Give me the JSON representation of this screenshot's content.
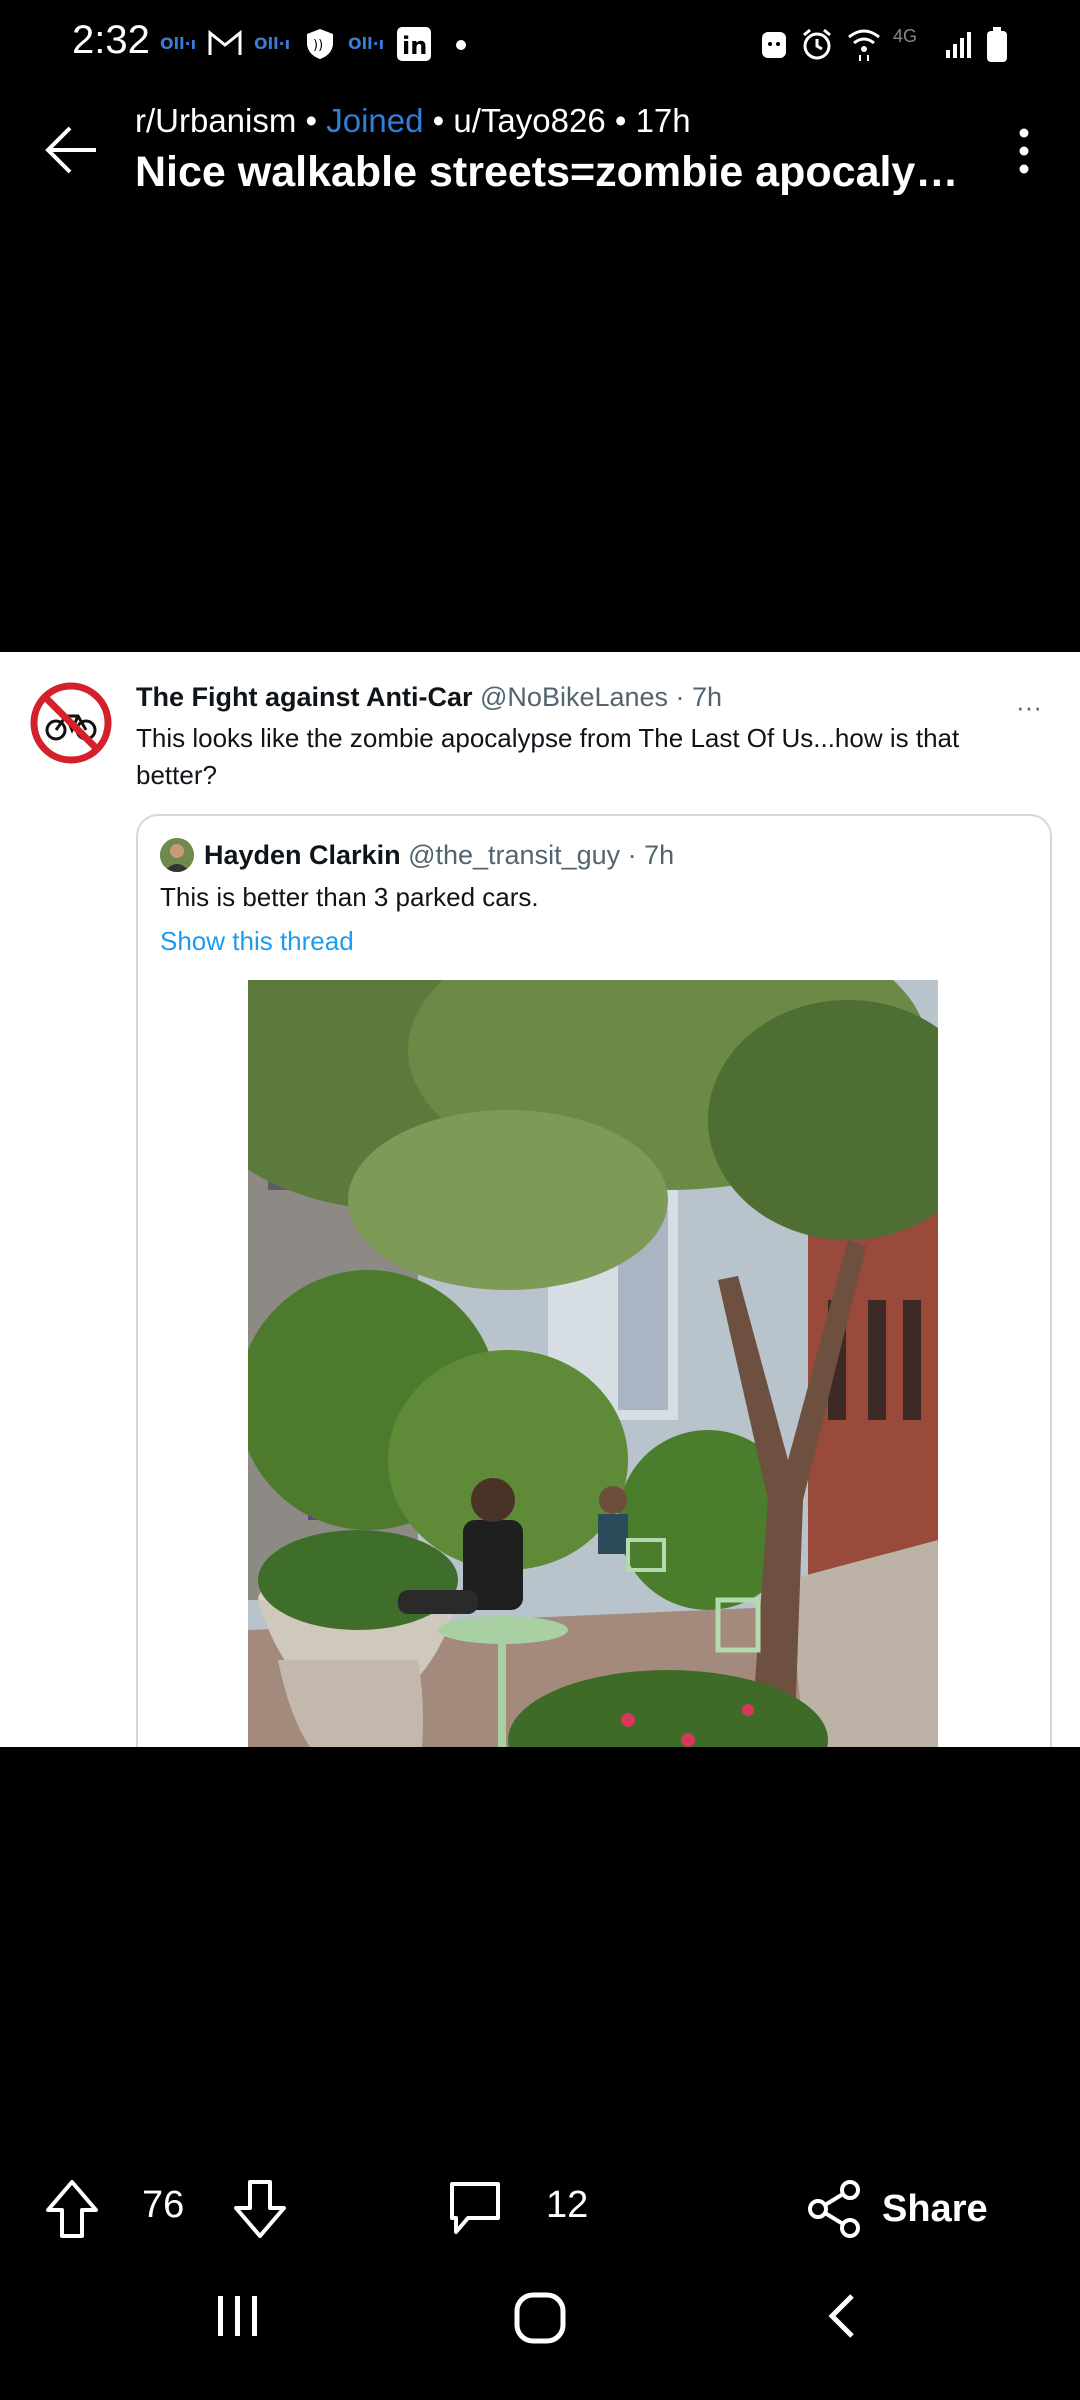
{
  "status_bar": {
    "time": "2:32",
    "network_label": "4G"
  },
  "header": {
    "subreddit": "r/Urbanism",
    "sep1": " • ",
    "joined": "Joined",
    "sep2": " • ",
    "author": "u/Tayo826",
    "sep3": " • ",
    "age": "17h",
    "title": "Nice walkable streets=zombie apocalypse"
  },
  "tweet": {
    "name": "The Fight against Anti-Car",
    "handle": "@NoBikeLanes",
    "time": " · 7h",
    "text": "This looks like the zombie apocalypse from The Last Of Us...how is that better?",
    "more": "···",
    "quote": {
      "name": "Hayden Clarkin",
      "handle": "@the_transit_guy",
      "time": " · 7h",
      "text": "This is better than 3 parked cars.",
      "link": "Show this thread"
    }
  },
  "actions": {
    "upvotes": "76",
    "comments": "12",
    "share_label": "Share"
  },
  "colors": {
    "accent_joined": "#2f7fd6",
    "tweet_link": "#1d9bf0",
    "background": "#000000"
  }
}
